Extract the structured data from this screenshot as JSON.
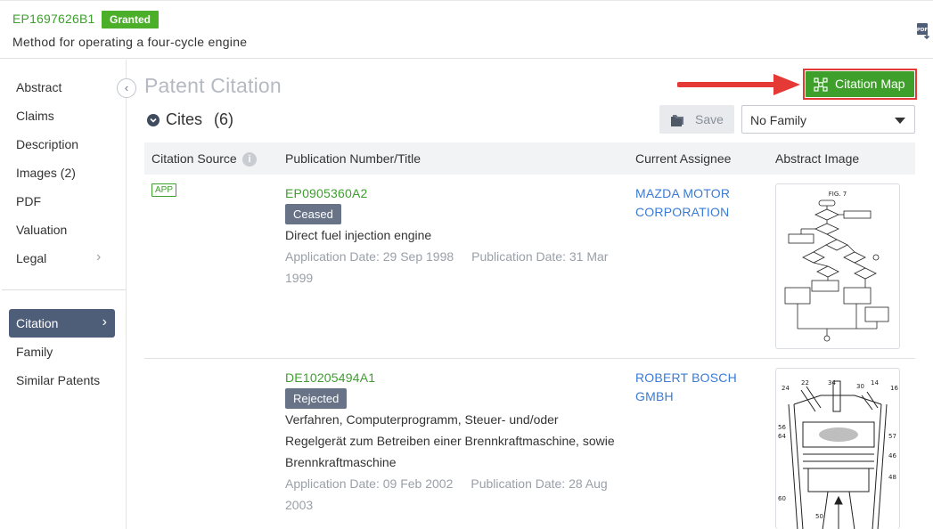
{
  "header": {
    "patent_number": "EP1697626B1",
    "status": "Granted",
    "title": "Method for operating a four-cycle engine",
    "pdf_icon": "pdf-download-icon"
  },
  "sidebar": {
    "items": [
      {
        "label": "Abstract"
      },
      {
        "label": "Claims"
      },
      {
        "label": "Description"
      },
      {
        "label": "Images (2)"
      },
      {
        "label": "PDF"
      },
      {
        "label": "Valuation"
      },
      {
        "label": "Legal",
        "has_children": true
      }
    ],
    "active_item": {
      "label": "Citation",
      "has_children": true
    },
    "lower_items": [
      {
        "label": "Family"
      },
      {
        "label": "Similar Patents"
      }
    ],
    "collapse_icon": "chevron-left-icon"
  },
  "main": {
    "section_title": "Patent Citation",
    "citation_map_button": "Citation Map",
    "cites_label": "Cites",
    "cites_count": "(6)",
    "save_button": "Save",
    "family_filter": {
      "selected": "No Family"
    },
    "table": {
      "columns": [
        "Citation Source",
        "Publication Number/Title",
        "Current Assignee",
        "Abstract Image"
      ],
      "rows": [
        {
          "source_tag": "APP",
          "publication_number": "EP0905360A2",
          "status": "Ceased",
          "title": "Direct fuel injection engine",
          "application_date": "Application Date: 29 Sep 1998",
          "publication_date_line1": "Publication Date: 31 Mar",
          "publication_date_line2": "1999",
          "assignee_line1": "MAZDA MOTOR",
          "assignee_line2": "CORPORATION",
          "image_caption": "FIG. 7"
        },
        {
          "source_tag": "",
          "publication_number": "DE10205494A1",
          "status": "Rejected",
          "title_line1": "Verfahren, Computerprogramm, Steuer- und/oder",
          "title_line2": "Regelgerät zum Betreiben einer Brennkraftmaschine, sowie",
          "title_line3": "Brennkraftmaschine",
          "application_date": "Application Date: 09 Feb 2002",
          "publication_date_line1": "Publication Date: 28 Aug",
          "publication_date_line2": "2003",
          "assignee_line1": "ROBERT BOSCH",
          "assignee_line2": "GMBH",
          "image_labels": [
            "24",
            "22",
            "34",
            "30",
            "14",
            "16",
            "56",
            "64",
            "57",
            "46",
            "48",
            "60",
            "50"
          ]
        }
      ]
    }
  },
  "colors": {
    "brand_green": "#3ea02a",
    "link_blue": "#3a7bd5",
    "nav_active": "#4e5d78",
    "annotation_red": "#e53935"
  }
}
